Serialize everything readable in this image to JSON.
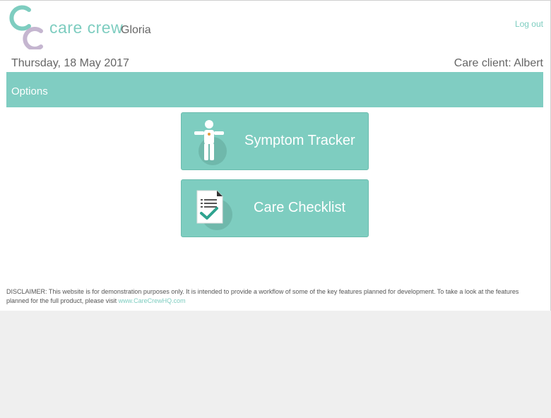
{
  "header": {
    "brand": "care crew",
    "user": "Gloria",
    "logout_label": "Log out"
  },
  "info": {
    "date": "Thursday, 18 May 2017",
    "client": "Care client: Albert"
  },
  "options": {
    "title": "Options",
    "tiles": [
      {
        "label": "Symptom Tracker",
        "icon": "body-figure-icon"
      },
      {
        "label": "Care Checklist",
        "icon": "checklist-document-icon"
      }
    ]
  },
  "disclaimer": {
    "text": "DISCLAIMER: This website is for demonstration purposes only. It is intended to provide a workflow of some of the key features planned for development. To take a look at the features planned for the full product, please visit ",
    "link": "www.CareCrewHQ.com"
  },
  "colors": {
    "accent": "#7ecdc0",
    "logo_secondary": "#c5b6d0",
    "background": "#efefef"
  }
}
